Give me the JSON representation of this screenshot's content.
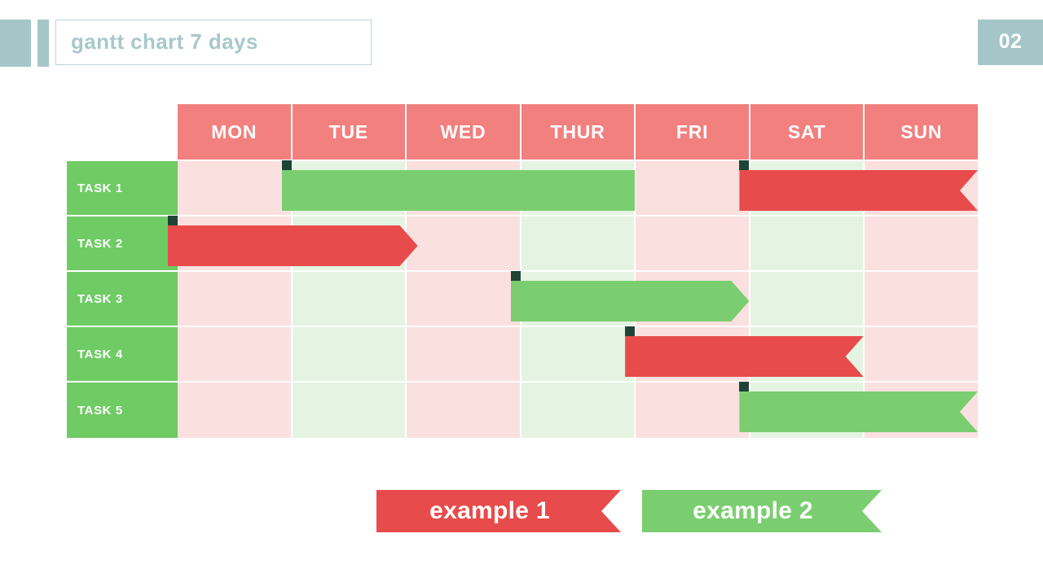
{
  "header": {
    "title": "gantt chart  7 days",
    "page_number": "02",
    "accent_color": "#a5c6c9"
  },
  "chart_data": {
    "type": "bar",
    "title": "gantt chart  7 days",
    "xlabel": "",
    "ylabel": "",
    "categories": [
      "MON",
      "TUE",
      "WED",
      "THUR",
      "FRI",
      "SAT",
      "SUN"
    ],
    "tasks": [
      "TASK 1",
      "TASK 2",
      "TASK 3",
      "TASK 4",
      "TASK 5"
    ],
    "column_backgrounds": [
      "pink",
      "green",
      "pink",
      "green",
      "pink",
      "green",
      "pink"
    ],
    "header_color": "#f1807e",
    "task_label_color": "#6fcb64",
    "bar_colors": {
      "example 1": "#e84b4b",
      "example 2": "#7ace6f"
    },
    "bars": [
      {
        "task": "TASK 1",
        "series": "example 2",
        "color": "#7ace6f",
        "start_day": "TUE",
        "end_day": "THUR",
        "start": 1.0,
        "end": 4.0,
        "end_shape": "flat"
      },
      {
        "task": "TASK 1",
        "series": "example 1",
        "color": "#e84b4b",
        "start_day": "SAT",
        "end_day": "SUN",
        "start": 5.0,
        "end": 7.0,
        "end_shape": "notch"
      },
      {
        "task": "TASK 2",
        "series": "example 1",
        "color": "#e84b4b",
        "start_day": "MON",
        "end_day": "WED",
        "start": 0.0,
        "end": 2.1,
        "end_shape": "point"
      },
      {
        "task": "TASK 3",
        "series": "example 2",
        "color": "#7ace6f",
        "start_day": "THUR",
        "end_day": "SAT",
        "start": 3.0,
        "end": 5.0,
        "end_shape": "point"
      },
      {
        "task": "TASK 4",
        "series": "example 1",
        "color": "#e84b4b",
        "start_day": "FRI",
        "end_day": "SAT",
        "start": 4.0,
        "end": 6.0,
        "end_shape": "notch"
      },
      {
        "task": "TASK 5",
        "series": "example 2",
        "color": "#7ace6f",
        "start_day": "SAT",
        "end_day": "SUN",
        "start": 5.0,
        "end": 7.0,
        "end_shape": "notch"
      }
    ]
  },
  "days": [
    {
      "label": "MON"
    },
    {
      "label": "TUE"
    },
    {
      "label": "WED"
    },
    {
      "label": "THUR"
    },
    {
      "label": "FRI"
    },
    {
      "label": "SAT"
    },
    {
      "label": "SUN"
    }
  ],
  "tasks": [
    {
      "label": "TASK 1"
    },
    {
      "label": "TASK 2"
    },
    {
      "label": "TASK 3"
    },
    {
      "label": "TASK 4"
    },
    {
      "label": "TASK 5"
    }
  ],
  "legend": [
    {
      "label": "example 1",
      "color": "#e84b4b"
    },
    {
      "label": "example 2",
      "color": "#7ace6f"
    }
  ]
}
